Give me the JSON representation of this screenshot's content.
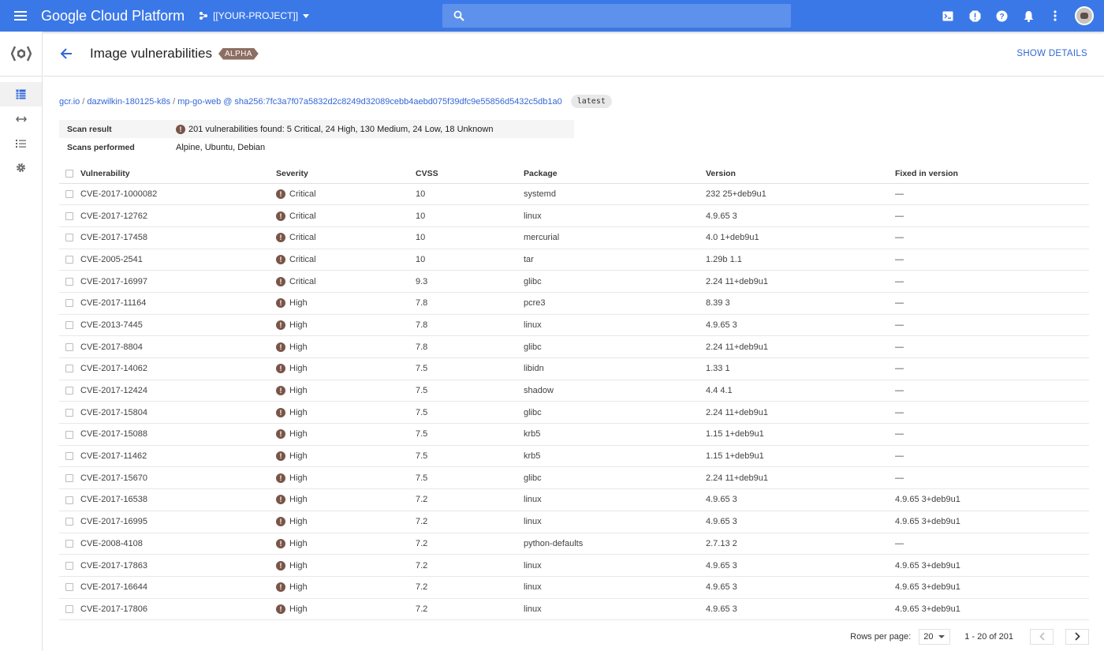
{
  "app": {
    "brand": "Google Cloud Platform",
    "project": "[[YOUR-PROJECT]]"
  },
  "header": {
    "title": "Image vulnerabilities",
    "badge": "ALPHA",
    "show_details": "SHOW DETAILS"
  },
  "breadcrumb": {
    "registry": "gcr.io",
    "project": "dazwilkin-180125-k8s",
    "image": "mp-go-web",
    "at": "@",
    "digest": "sha256:7fc3a7f07a5832d2c8249d32089cebb4aebd075f39dfc9e55856d5432c5db1a0",
    "tag": "latest"
  },
  "scan": {
    "result_label": "Scan result",
    "result_value": "201 vulnerabilities found: 5 Critical, 24 High, 130 Medium, 24 Low, 18 Unknown",
    "performed_label": "Scans performed",
    "performed_value": "Alpine, Ubuntu, Debian"
  },
  "table": {
    "headers": {
      "vulnerability": "Vulnerability",
      "severity": "Severity",
      "cvss": "CVSS",
      "package": "Package",
      "version": "Version",
      "fixed": "Fixed in version"
    },
    "rows": [
      {
        "id": "CVE-2017-1000082",
        "severity": "Critical",
        "cvss": "10",
        "package": "systemd",
        "version": "232 25+deb9u1",
        "fixed": "—"
      },
      {
        "id": "CVE-2017-12762",
        "severity": "Critical",
        "cvss": "10",
        "package": "linux",
        "version": "4.9.65 3",
        "fixed": "—"
      },
      {
        "id": "CVE-2017-17458",
        "severity": "Critical",
        "cvss": "10",
        "package": "mercurial",
        "version": "4.0 1+deb9u1",
        "fixed": "—"
      },
      {
        "id": "CVE-2005-2541",
        "severity": "Critical",
        "cvss": "10",
        "package": "tar",
        "version": "1.29b 1.1",
        "fixed": "—"
      },
      {
        "id": "CVE-2017-16997",
        "severity": "Critical",
        "cvss": "9.3",
        "package": "glibc",
        "version": "2.24 11+deb9u1",
        "fixed": "—"
      },
      {
        "id": "CVE-2017-11164",
        "severity": "High",
        "cvss": "7.8",
        "package": "pcre3",
        "version": "8.39 3",
        "fixed": "—"
      },
      {
        "id": "CVE-2013-7445",
        "severity": "High",
        "cvss": "7.8",
        "package": "linux",
        "version": "4.9.65 3",
        "fixed": "—"
      },
      {
        "id": "CVE-2017-8804",
        "severity": "High",
        "cvss": "7.8",
        "package": "glibc",
        "version": "2.24 11+deb9u1",
        "fixed": "—"
      },
      {
        "id": "CVE-2017-14062",
        "severity": "High",
        "cvss": "7.5",
        "package": "libidn",
        "version": "1.33 1",
        "fixed": "—"
      },
      {
        "id": "CVE-2017-12424",
        "severity": "High",
        "cvss": "7.5",
        "package": "shadow",
        "version": "4.4 4.1",
        "fixed": "—"
      },
      {
        "id": "CVE-2017-15804",
        "severity": "High",
        "cvss": "7.5",
        "package": "glibc",
        "version": "2.24 11+deb9u1",
        "fixed": "—"
      },
      {
        "id": "CVE-2017-15088",
        "severity": "High",
        "cvss": "7.5",
        "package": "krb5",
        "version": "1.15 1+deb9u1",
        "fixed": "—"
      },
      {
        "id": "CVE-2017-11462",
        "severity": "High",
        "cvss": "7.5",
        "package": "krb5",
        "version": "1.15 1+deb9u1",
        "fixed": "—"
      },
      {
        "id": "CVE-2017-15670",
        "severity": "High",
        "cvss": "7.5",
        "package": "glibc",
        "version": "2.24 11+deb9u1",
        "fixed": "—"
      },
      {
        "id": "CVE-2017-16538",
        "severity": "High",
        "cvss": "7.2",
        "package": "linux",
        "version": "4.9.65 3",
        "fixed": "4.9.65 3+deb9u1"
      },
      {
        "id": "CVE-2017-16995",
        "severity": "High",
        "cvss": "7.2",
        "package": "linux",
        "version": "4.9.65 3",
        "fixed": "4.9.65 3+deb9u1"
      },
      {
        "id": "CVE-2008-4108",
        "severity": "High",
        "cvss": "7.2",
        "package": "python-defaults",
        "version": "2.7.13 2",
        "fixed": "—"
      },
      {
        "id": "CVE-2017-17863",
        "severity": "High",
        "cvss": "7.2",
        "package": "linux",
        "version": "4.9.65 3",
        "fixed": "4.9.65 3+deb9u1"
      },
      {
        "id": "CVE-2017-16644",
        "severity": "High",
        "cvss": "7.2",
        "package": "linux",
        "version": "4.9.65 3",
        "fixed": "4.9.65 3+deb9u1"
      },
      {
        "id": "CVE-2017-17806",
        "severity": "High",
        "cvss": "7.2",
        "package": "linux",
        "version": "4.9.65 3",
        "fixed": "4.9.65 3+deb9u1"
      }
    ]
  },
  "pagination": {
    "rows_per_page_label": "Rows per page:",
    "rows_per_page": "20",
    "range": "1 - 20 of 201"
  },
  "icons": {
    "top": [
      "menu-icon",
      "project-icon",
      "search-icon",
      "cloud-shell-icon",
      "alert-icon",
      "help-icon",
      "notifications-icon",
      "more-vert-icon"
    ],
    "rail": [
      "container-registry-icon",
      "images-icon",
      "triggers-icon",
      "build-history-icon",
      "settings-icon"
    ],
    "severity": "severity-alert-icon"
  },
  "colors": {
    "topbar": "#3b78e7",
    "accent": "#3367d6",
    "severity": "#795548",
    "badge": "#8d6e63"
  }
}
